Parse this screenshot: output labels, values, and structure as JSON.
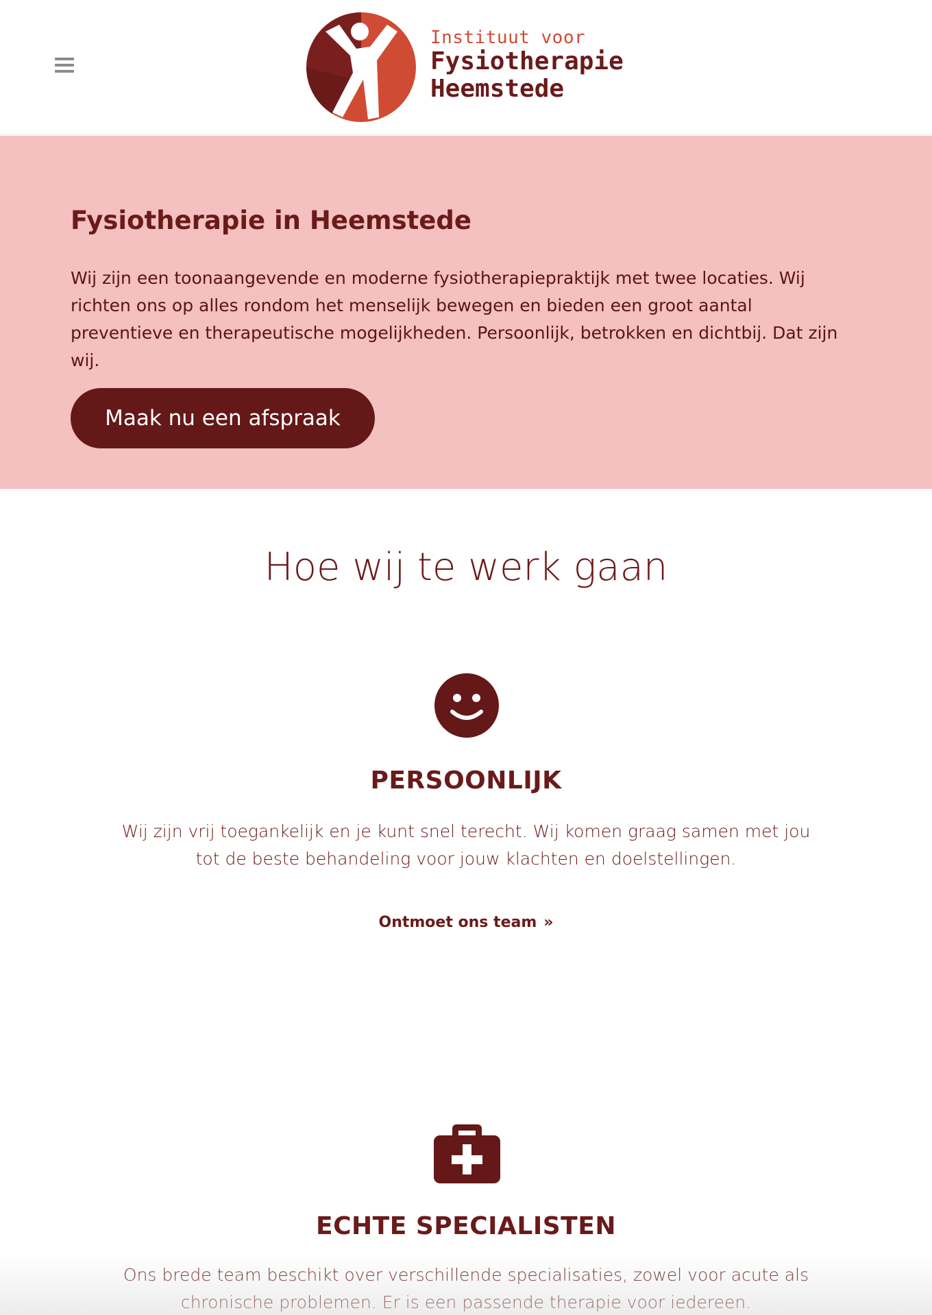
{
  "header": {
    "logo": {
      "line1": "Instituut voor",
      "line2": "Fysiotherapie",
      "line3": "Heemstede"
    },
    "menu_icon": "hamburger-icon"
  },
  "hero": {
    "title": "Fysiotherapie in Heemstede",
    "text": "Wij zijn een toonaangevende en moderne fysiotherapiepraktijk met twee locaties. Wij richten ons op alles rondom het menselijk bewegen en bieden een groot aantal preventieve en therapeutische mogelijkheden. Persoonlijk, betrokken en dichtbij. Dat zijn wij.",
    "cta_label": "Maak nu een afspraak"
  },
  "section": {
    "title": "Hoe wij te werk gaan"
  },
  "features": [
    {
      "icon": "smiley-icon",
      "heading": "PERSOONLIJK",
      "text": "Wij zijn vrij toegankelijk en je kunt snel terecht. Wij komen graag samen met jou tot de beste behandeling voor jouw klachten en doelstellingen.",
      "link": "Ontmoet ons team"
    },
    {
      "icon": "medkit-icon",
      "heading": "ECHTE SPECIALISTEN",
      "text": "Ons brede team beschikt over verschillende specialisaties, zowel voor acute als chronische problemen. Er is een passende therapie voor iedereen."
    }
  ],
  "colors": {
    "brand_dark": "#6b1a1a",
    "brand_orange": "#d04b33",
    "hero_bg": "#f4c0c0",
    "button_bg": "#651818"
  }
}
